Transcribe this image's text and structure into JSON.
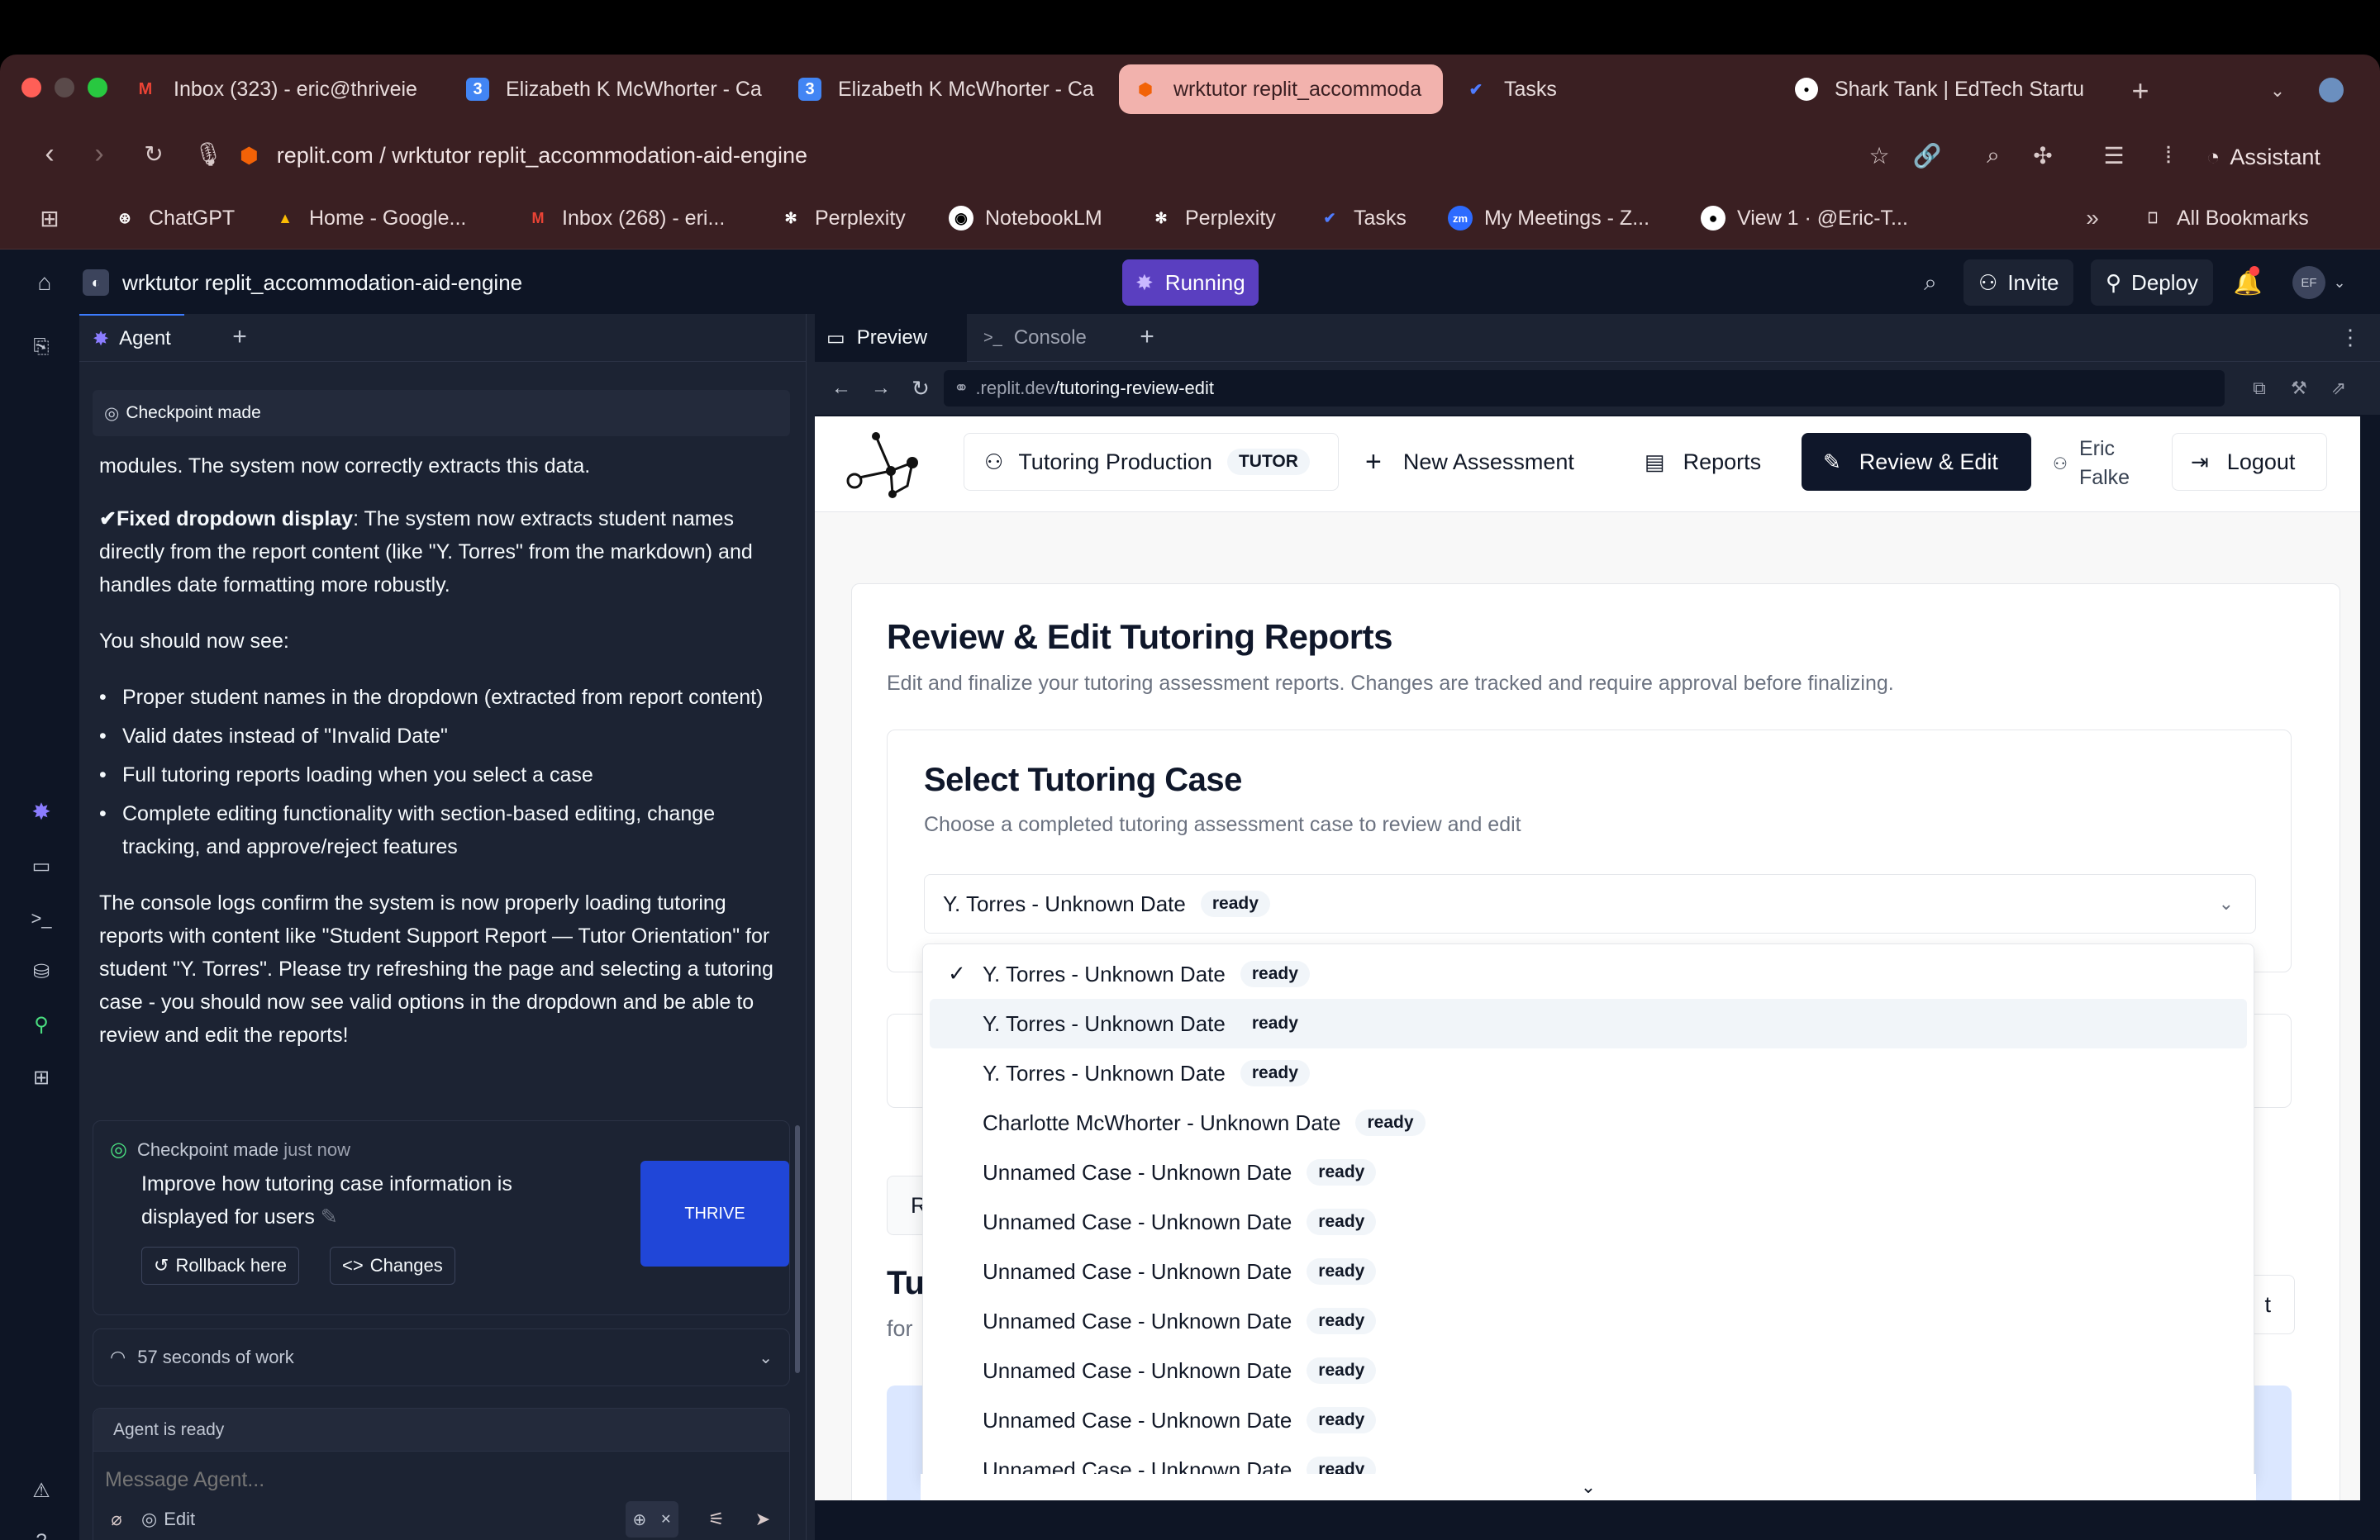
{
  "browser": {
    "tabs": [
      {
        "label": "Inbox (323) - eric@thriveie",
        "icon": "gmail-icon"
      },
      {
        "label": "Elizabeth K McWhorter - Ca",
        "icon": "calendar-icon"
      },
      {
        "label": "Elizabeth K McWhorter - Ca",
        "icon": "calendar-icon"
      },
      {
        "label": "wrktutor replit_accommoda",
        "icon": "replit-icon"
      },
      {
        "label": "Tasks",
        "icon": "tasks-icon"
      },
      {
        "label": "Shark Tank | EdTech Startu",
        "icon": "shark-tank-icon"
      }
    ],
    "url": "replit.com / wrktutor replit_accommodation-aid-engine",
    "assistant_label": "Assistant",
    "bookmarks": [
      {
        "label": "ChatGPT",
        "icon": "chatgpt-icon"
      },
      {
        "label": "Home - Google...",
        "icon": "google-drive-icon"
      },
      {
        "label": "Inbox (268) - eri...",
        "icon": "gmail-icon"
      },
      {
        "label": "Perplexity",
        "icon": "perplexity-icon"
      },
      {
        "label": "NotebookLM",
        "icon": "notebooklm-icon"
      },
      {
        "label": "Perplexity",
        "icon": "perplexity-icon"
      },
      {
        "label": "Tasks",
        "icon": "tasks-icon"
      },
      {
        "label": "My Meetings - Z...",
        "icon": "zoom-icon"
      },
      {
        "label": "View 1 · @Eric-T...",
        "icon": "github-icon"
      }
    ],
    "all_bookmarks": "All Bookmarks"
  },
  "replit": {
    "project": "wrktutor replit_accommodation-aid-engine",
    "run_status": "Running",
    "invite": "Invite",
    "deploy": "Deploy",
    "avatar": "EF",
    "agent_tab": "Agent",
    "preview_tab": "Preview",
    "console_tab": "Console",
    "preview_url_host": ".replit.dev",
    "preview_url_path": "/tutoring-review-edit"
  },
  "agent": {
    "checkpoint_top": "Checkpoint made",
    "partial_line": "modules. The system now correctly extracts this data.",
    "fixed_heading": "✔Fixed dropdown display",
    "fixed_body": ": The system now extracts student names directly from the report content (like \"Y. Torres\" from the markdown) and handles date formatting more robustly.",
    "should_see": "You should now see:",
    "bullets": [
      "Proper student names in the dropdown (extracted from report content)",
      "Valid dates instead of \"Invalid Date\"",
      "Full tutoring reports loading when you select a case",
      "Complete editing functionality with section-based editing, change tracking, and approve/reject features"
    ],
    "console_para": "The console logs confirm the system is now properly loading tutoring reports with content like \"Student Support Report — Tutor Orientation\" for student \"Y. Torres\". Please try refreshing the page and selecting a tutoring case - you should now see valid options in the dropdown and be able to review and edit the reports!",
    "checkpoint_label": "Checkpoint made",
    "checkpoint_time": "just now",
    "checkpoint_desc": "Improve how tutoring case information is displayed for users",
    "thumb_text": "THRIVE",
    "rollback": "Rollback here",
    "changes": "Changes",
    "work_time": "57 seconds of work",
    "status": "Agent is ready",
    "input_placeholder": "Message Agent...",
    "edit": "Edit"
  },
  "app": {
    "nav": {
      "production": "Tutoring Production",
      "role_badge": "TUTOR",
      "new_assessment": "New Assessment",
      "reports": "Reports",
      "review_edit": "Review & Edit",
      "user_first": "Eric",
      "user_last": "Falke",
      "logout": "Logout"
    },
    "title": "Review & Edit Tutoring Reports",
    "subtitle": "Edit and finalize your tutoring assessment reports. Changes are tracked and require approval before finalizing.",
    "select_title": "Select Tutoring Case",
    "select_subtitle": "Choose a completed tutoring assessment case to review and edit",
    "selected_value": "Y. Torres - Unknown Date",
    "selected_badge": "ready",
    "partial_R": "R",
    "partial_Tu": "Tu",
    "partial_for": "for",
    "partial_t": "t",
    "options": [
      {
        "label": "Y. Torres - Unknown Date",
        "badge": "ready"
      },
      {
        "label": "Y. Torres - Unknown Date",
        "badge": "ready"
      },
      {
        "label": "Y. Torres - Unknown Date",
        "badge": "ready"
      },
      {
        "label": "Charlotte McWhorter - Unknown Date",
        "badge": "ready"
      },
      {
        "label": "Unnamed Case - Unknown Date",
        "badge": "ready"
      },
      {
        "label": "Unnamed Case - Unknown Date",
        "badge": "ready"
      },
      {
        "label": "Unnamed Case - Unknown Date",
        "badge": "ready"
      },
      {
        "label": "Unnamed Case - Unknown Date",
        "badge": "ready"
      },
      {
        "label": "Unnamed Case - Unknown Date",
        "badge": "ready"
      },
      {
        "label": "Unnamed Case - Unknown Date",
        "badge": "ready"
      },
      {
        "label": "Unnamed Case - Unknown Date",
        "badge": "ready"
      }
    ]
  }
}
